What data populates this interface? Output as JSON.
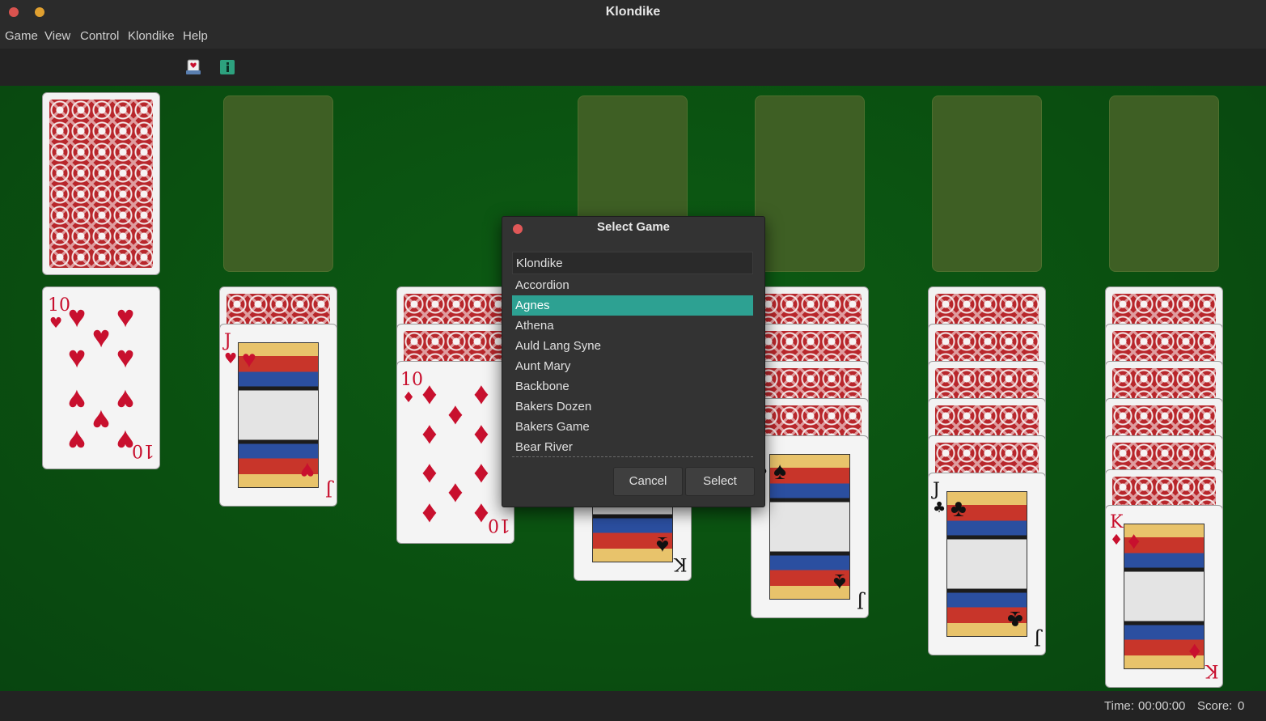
{
  "window": {
    "title": "Klondike"
  },
  "menu": [
    "Game",
    "View",
    "Control",
    "Klondike",
    "Help"
  ],
  "toolbar": {
    "icons": [
      "card-game-icon",
      "info-icon"
    ]
  },
  "tableau": {
    "col1": {
      "rank": "10",
      "suit": "♥"
    },
    "col2": {
      "rank": "J",
      "suit": "♥"
    },
    "col3": {
      "rank": "10",
      "suit": "♦"
    },
    "col4": {
      "rank": "K",
      "suit": "♠"
    },
    "col5": {
      "rank": "J",
      "suit": "♠"
    },
    "col6": {
      "rank": "J",
      "suit": "♣"
    },
    "col7": {
      "rank": "K",
      "suit": "♦"
    }
  },
  "dialog": {
    "title": "Select Game",
    "search_value": "Klondike",
    "items": [
      "Accordion",
      "Agnes",
      "Athena",
      "Auld Lang Syne",
      "Aunt Mary",
      "Backbone",
      "Bakers Dozen",
      "Bakers Game",
      "Bear River"
    ],
    "selected": "Agnes",
    "cancel_label": "Cancel",
    "select_label": "Select"
  },
  "status": {
    "time_label": "Time:",
    "time_value": "00:00:00",
    "score_label": "Score:",
    "score_value": "0"
  }
}
